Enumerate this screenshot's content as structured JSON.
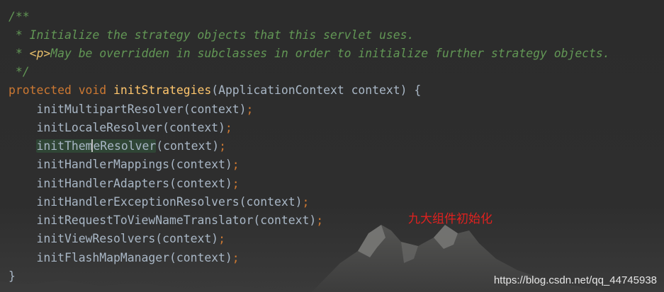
{
  "editor": {
    "theme_colors": {
      "background": "#2b2b2b",
      "comment": "#629755",
      "html_tag": "#e8bf6a",
      "keyword": "#cc7832",
      "method_declaration": "#ffc66d",
      "plain": "#a9b7c6"
    },
    "doc_comment": {
      "open": "/**",
      "line1": " * Initialize the strategy objects that this servlet uses.",
      "line2_prefix": " * ",
      "line2_tag": "<p>",
      "line2_text": "May be overridden in subclasses in order to initialize further strategy objects.",
      "close": " */"
    },
    "signature": {
      "modifier": "protected",
      "return_type": "void",
      "method_name": "initStrategies",
      "params": "(ApplicationContext context) {"
    },
    "calls": [
      "initMultipartResolver(context)",
      "initLocaleResolver(context)",
      "initThemeResolver(context)",
      "initHandlerMappings(context)",
      "initHandlerAdapters(context)",
      "initHandlerExceptionResolvers(context)",
      "initRequestToViewNameTranslator(context)",
      "initViewResolvers(context)",
      "initFlashMapManager(context)"
    ],
    "cursor_call": {
      "before_caret": "initThem",
      "after_caret": "eResolver",
      "args": "(context)"
    },
    "semicolon": ";",
    "closing_brace": "}"
  },
  "annotation": "九大组件初始化",
  "watermark": "https://blog.csdn.net/qq_44745938"
}
